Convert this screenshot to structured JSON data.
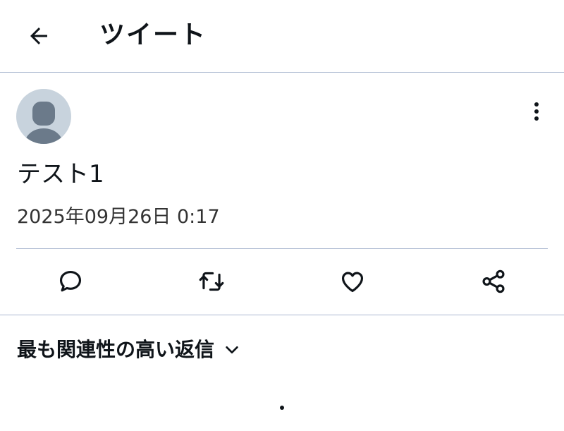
{
  "header": {
    "back_icon": "arrow-left-icon",
    "title": "ツイート"
  },
  "tweet": {
    "avatar_icon": "default-avatar-icon",
    "more_icon": "vertical-dots-icon",
    "text": "テスト1",
    "timestamp": "2025年09月26日 0:17"
  },
  "actions": [
    {
      "icon": "reply-icon"
    },
    {
      "icon": "retweet-icon"
    },
    {
      "icon": "like-heart-icon"
    },
    {
      "icon": "share-icon"
    }
  ],
  "replies": {
    "sort_label": "最も関連性の高い返信",
    "sort_icon": "chevron-down-icon"
  },
  "colors": {
    "text": "#0f1419",
    "divider": "#aab8d0",
    "avatar_bg": "#c8d3dd",
    "avatar_fg": "#6b7a8a"
  }
}
